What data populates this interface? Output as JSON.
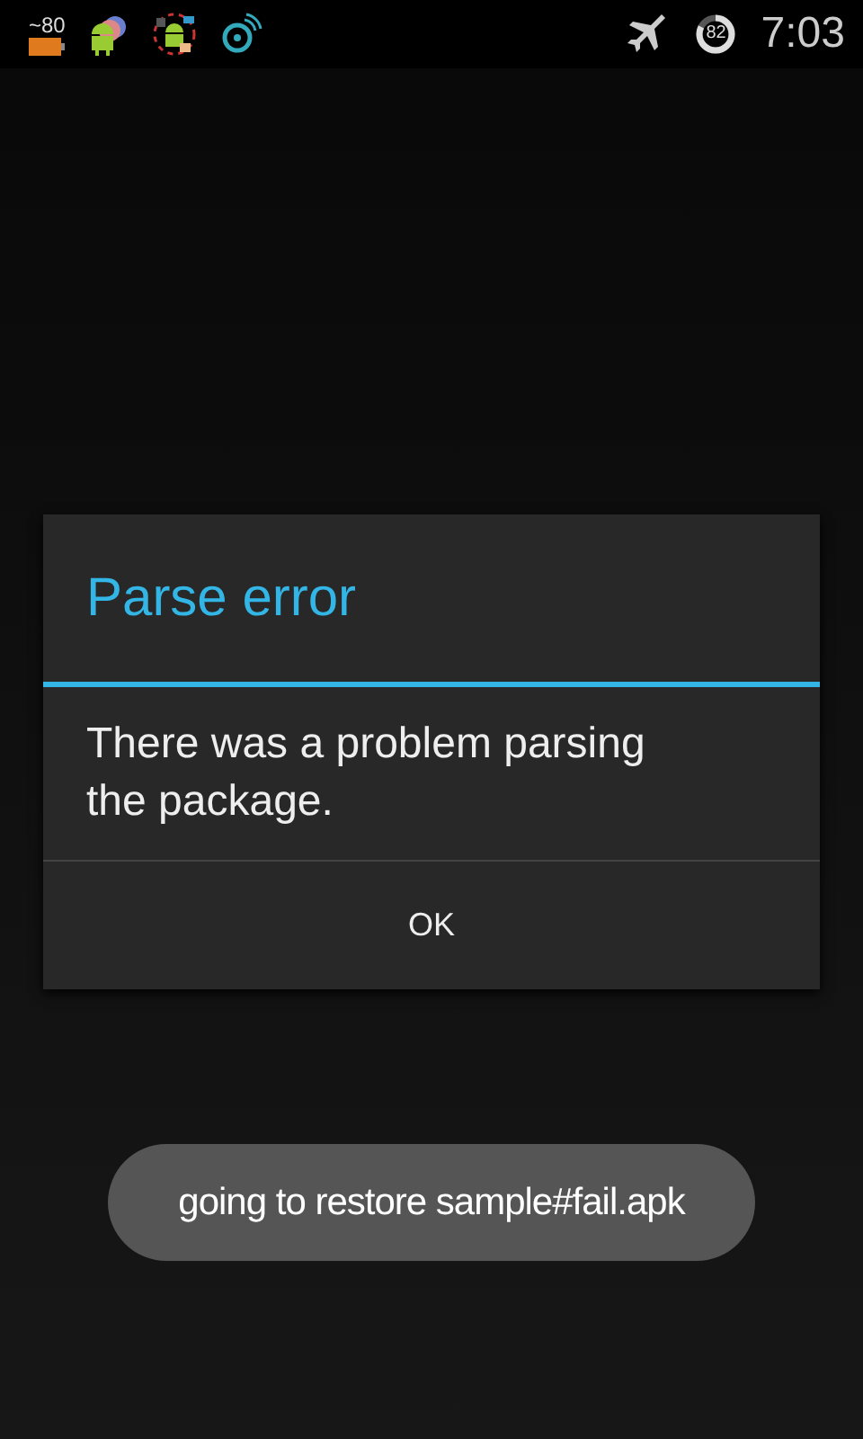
{
  "status_bar": {
    "battery_label": "~80",
    "ring": {
      "value": "82",
      "level": 0.82
    },
    "time": "7:03"
  },
  "dialog": {
    "title": "Parse error",
    "message": "There was a problem parsing the package.",
    "buttons": [
      "OK"
    ]
  },
  "toast": {
    "text": "going to restore sample#fail.apk"
  }
}
